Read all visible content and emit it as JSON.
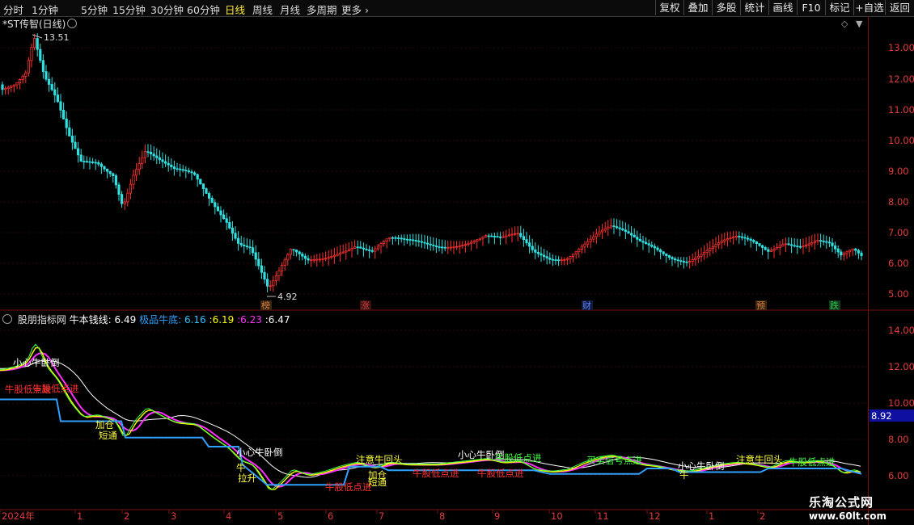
{
  "toolbar": {
    "tabs": [
      "分时",
      "1分钟",
      "5分钟",
      "15分钟",
      "30分钟",
      "60分钟",
      "日线",
      "周线",
      "月线",
      "多周期",
      "更多"
    ],
    "active_tab": "日线",
    "right_buttons": [
      "复权",
      "叠加",
      "多股",
      "统计",
      "画线",
      "F10",
      "标记",
      "+自选",
      "返回"
    ]
  },
  "main_chart": {
    "title": "*ST传智(日线)",
    "high_label": "13.51",
    "low_label": "4.92",
    "y_ticks": [
      "13.00",
      "12.00",
      "11.00",
      "10.00",
      "9.00",
      "8.00",
      "7.00",
      "6.00",
      "5.00"
    ],
    "event_marks": [
      {
        "text": "榜",
        "color": "#d08040"
      },
      {
        "text": "涨",
        "color": "#d04040"
      },
      {
        "text": "财",
        "color": "#4060d0"
      },
      {
        "text": "预",
        "color": "#d08040"
      },
      {
        "text": "跌",
        "color": "#20a040"
      }
    ]
  },
  "indicator": {
    "name": "股朋指标网",
    "label1": "牛本钱线:",
    "value1": "6.49",
    "label2": "极品牛底:",
    "value2": "6.16",
    "value3": "6.19",
    "value4": "6.23",
    "value5": "6.47",
    "y_ticks": [
      "14.00",
      "12.00",
      "10.00",
      "8.00",
      "6.00"
    ],
    "current_price": "8.92",
    "annotations": [
      "小心牛卧倒",
      "牛股低点进",
      "牛股低点进",
      "加仓",
      "短通",
      "小心牛卧倒",
      "拉升",
      "牛",
      "牛股低点进",
      "注意牛回头",
      "加仓",
      "短通",
      "牛股低点进",
      "小心牛卧倒",
      "牛股低点进",
      "牛股低点进",
      "买卖信号点进",
      "小心牛卧倒",
      "注意牛回头",
      "牛股低点进",
      "牛"
    ]
  },
  "x_axis": {
    "labels": [
      "2024年",
      "1",
      "2",
      "3",
      "4",
      "5",
      "6",
      "7",
      "8",
      "9",
      "10",
      "11",
      "12",
      "1",
      "2"
    ]
  },
  "watermark": {
    "line1": "乐淘公式网",
    "line2": "www.60lt.com"
  },
  "colors": {
    "up": "#ff3030",
    "down": "#30e0e0",
    "axis": "#7a1010",
    "ma_white": "#ffffff",
    "ma_yellow": "#ffff00",
    "ma_magenta": "#ff30ff",
    "ma_green": "#40ff40",
    "base_line": "#30a0ff"
  }
}
